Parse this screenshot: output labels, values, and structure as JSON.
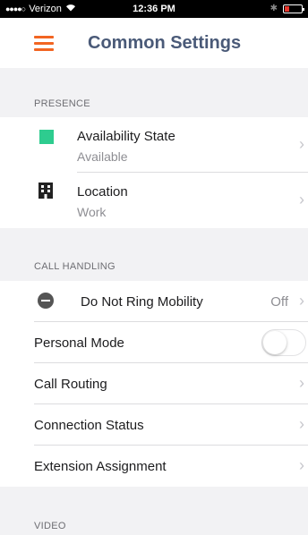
{
  "status_bar": {
    "carrier": "Verizon",
    "time": "12:36 PM"
  },
  "header": {
    "title": "Common Settings",
    "menu_icon": "hamburger-menu-icon"
  },
  "presence": {
    "header": "PRESENCE",
    "availability": {
      "label": "Availability State",
      "value": "Available",
      "icon": "green-square-icon"
    },
    "location": {
      "label": "Location",
      "value": "Work",
      "icon": "building-icon"
    }
  },
  "call_handling": {
    "header": "CALL HANDLING",
    "do_not_ring": {
      "label": "Do Not Ring Mobility",
      "value": "Off",
      "icon": "do-not-disturb-icon"
    },
    "personal_mode": {
      "label": "Personal Mode",
      "enabled": false
    },
    "call_routing": {
      "label": "Call Routing"
    },
    "connection_status": {
      "label": "Connection Status"
    },
    "extension_assignment": {
      "label": "Extension Assignment"
    }
  },
  "video": {
    "header": "VIDEO"
  },
  "colors": {
    "accent": "#f26522",
    "title": "#4a5a78",
    "available": "#2ecc8f"
  }
}
